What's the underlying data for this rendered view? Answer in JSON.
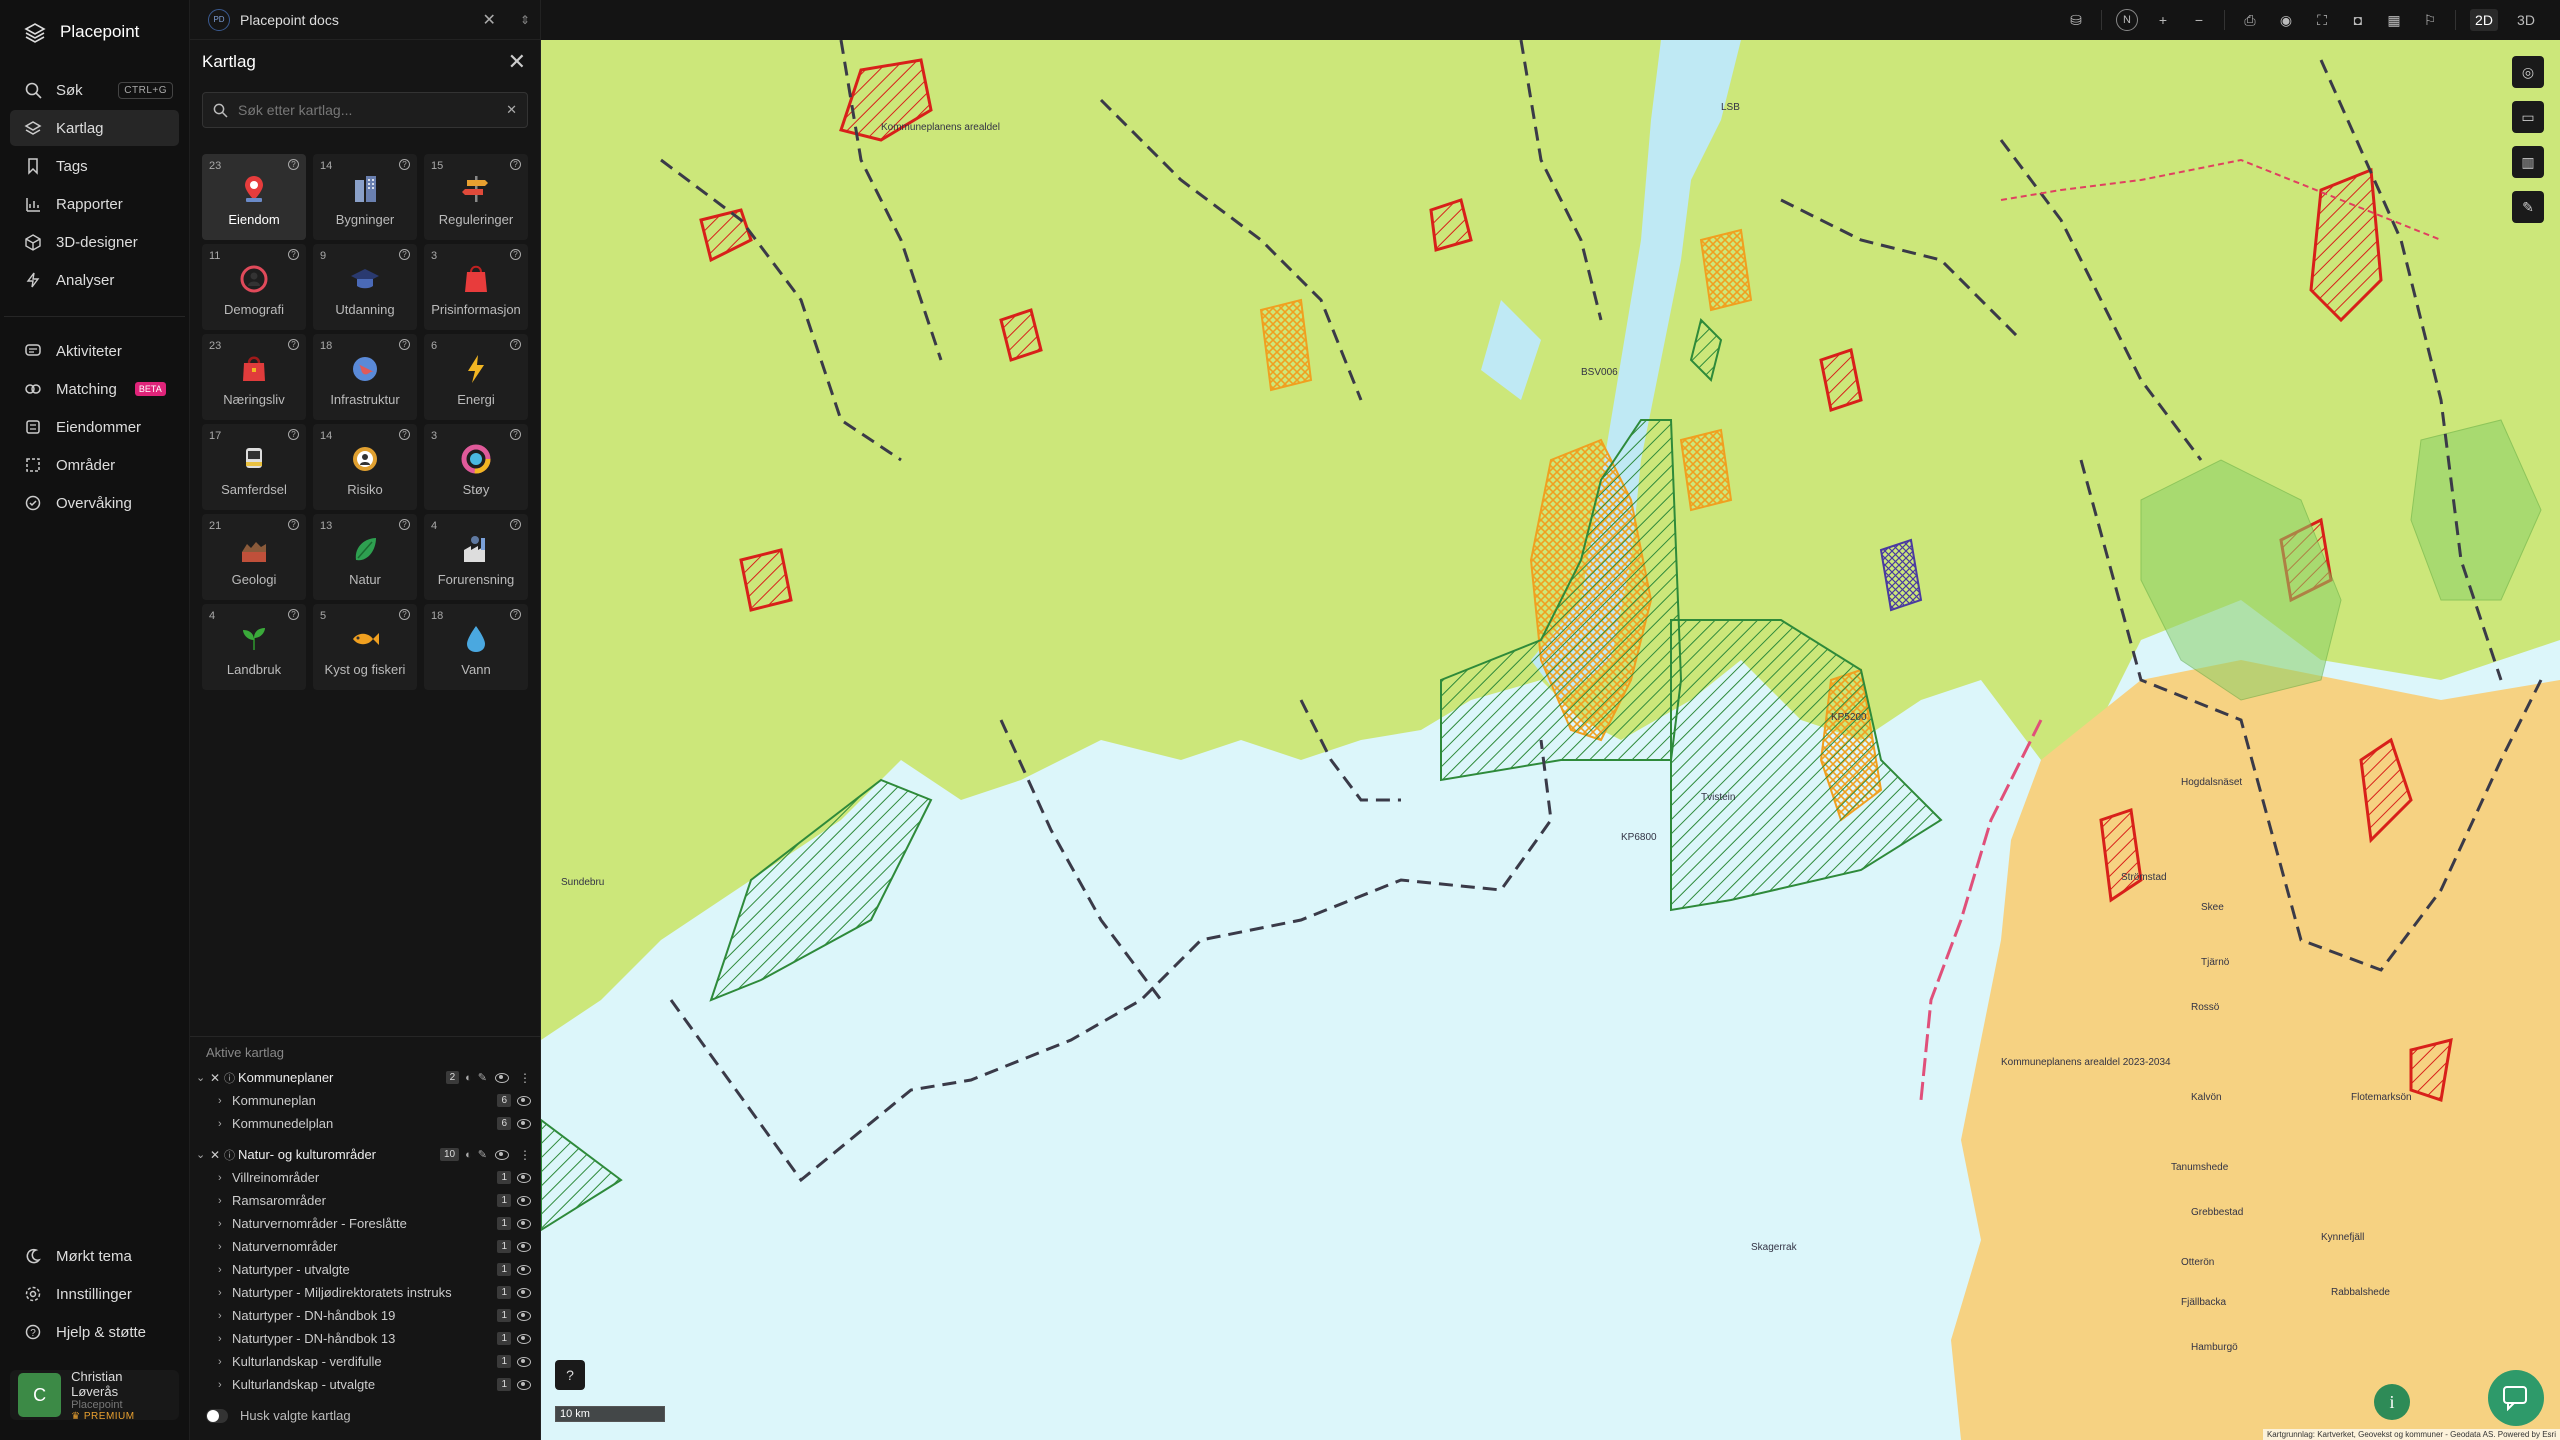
{
  "brand": {
    "name": "Placepoint"
  },
  "nav": {
    "items": [
      {
        "label": "Søk",
        "kbd": "CTRL+G",
        "icon": "search-icon"
      },
      {
        "label": "Kartlag",
        "icon": "layers-icon",
        "active": true
      },
      {
        "label": "Tags",
        "icon": "bookmark-icon"
      },
      {
        "label": "Rapporter",
        "icon": "chart-icon"
      },
      {
        "label": "3D-designer",
        "icon": "cube-icon"
      },
      {
        "label": "Analyser",
        "icon": "bolt-icon"
      }
    ],
    "items2": [
      {
        "label": "Aktiviteter",
        "icon": "message-icon"
      },
      {
        "label": "Matching",
        "badge": "BETA",
        "icon": "matching-icon"
      },
      {
        "label": "Eiendommer",
        "icon": "list-icon"
      },
      {
        "label": "Områder",
        "icon": "area-icon"
      },
      {
        "label": "Overvåking",
        "icon": "monitor-icon"
      }
    ],
    "bottom": [
      {
        "label": "Mørkt tema",
        "icon": "moon-icon"
      },
      {
        "label": "Innstillinger",
        "icon": "gear-icon"
      },
      {
        "label": "Hjelp & støtte",
        "icon": "help-icon"
      }
    ],
    "user": {
      "initial": "C",
      "name": "Christian Løverås",
      "org": "Placepoint",
      "plan": "PREMIUM"
    }
  },
  "doc_tab": {
    "badge": "PD",
    "label": "Placepoint docs"
  },
  "panel": {
    "title": "Kartlag",
    "search_placeholder": "Søk etter kartlag...",
    "tiles": [
      {
        "count": "23",
        "label": "Eiendom",
        "icon": "property-icon",
        "color": "#e63c3c",
        "active": true
      },
      {
        "count": "14",
        "label": "Bygninger",
        "icon": "buildings-icon",
        "color": "#8aa0c8"
      },
      {
        "count": "15",
        "label": "Reguleringer",
        "icon": "signpost-icon",
        "color": "#e8a030"
      },
      {
        "count": "11",
        "label": "Demografi",
        "icon": "demography-icon",
        "color": "#e04a5a"
      },
      {
        "count": "9",
        "label": "Utdanning",
        "icon": "graduation-icon",
        "color": "#4a6ab8"
      },
      {
        "count": "3",
        "label": "Prisinformasjon",
        "icon": "price-icon",
        "color": "#e83c3c"
      },
      {
        "count": "23",
        "label": "Næringsliv",
        "icon": "business-icon",
        "color": "#e03c3c"
      },
      {
        "count": "18",
        "label": "Infrastruktur",
        "icon": "globe-icon",
        "color": "#5a8ad8"
      },
      {
        "count": "6",
        "label": "Energi",
        "icon": "lightning-icon",
        "color": "#f2b622"
      },
      {
        "count": "17",
        "label": "Samferdsel",
        "icon": "bus-icon",
        "color": "#e8c040"
      },
      {
        "count": "14",
        "label": "Risiko",
        "icon": "risk-icon",
        "color": "#e0a030"
      },
      {
        "count": "3",
        "label": "Støy",
        "icon": "noise-icon",
        "color": "#e05a9a"
      },
      {
        "count": "21",
        "label": "Geologi",
        "icon": "geology-icon",
        "color": "#c0503a"
      },
      {
        "count": "13",
        "label": "Natur",
        "icon": "leaf-icon",
        "color": "#2ea050"
      },
      {
        "count": "4",
        "label": "Forurensning",
        "icon": "factory-icon",
        "color": "#7aa0d8"
      },
      {
        "count": "4",
        "label": "Landbruk",
        "icon": "plant-icon",
        "color": "#3aaa3a"
      },
      {
        "count": "5",
        "label": "Kyst og fiskeri",
        "icon": "fish-icon",
        "color": "#f0a020"
      },
      {
        "count": "18",
        "label": "Vann",
        "icon": "water-drop-icon",
        "color": "#4aa8e0"
      }
    ],
    "active_header": "Aktive kartlag",
    "groups": [
      {
        "label": "Kommuneplaner",
        "count": "2",
        "children": [
          {
            "label": "Kommuneplan",
            "count": "6"
          },
          {
            "label": "Kommunedelplan",
            "count": "6"
          }
        ]
      },
      {
        "label": "Natur- og kulturområder",
        "count": "10",
        "children": [
          {
            "label": "Villreinområder",
            "count": "1"
          },
          {
            "label": "Ramsarområder",
            "count": "1"
          },
          {
            "label": "Naturvernområder - Foreslåtte",
            "count": "1"
          },
          {
            "label": "Naturvernområder",
            "count": "1"
          },
          {
            "label": "Naturtyper - utvalgte",
            "count": "1"
          },
          {
            "label": "Naturtyper - Miljødirektoratets instruks",
            "count": "1"
          },
          {
            "label": "Naturtyper - DN-håndbok 19",
            "count": "1"
          },
          {
            "label": "Naturtyper - DN-håndbok 13",
            "count": "1"
          },
          {
            "label": "Kulturlandskap - verdifulle",
            "count": "1"
          },
          {
            "label": "Kulturlandskap - utvalgte",
            "count": "1"
          }
        ]
      }
    ],
    "remember_label": "Husk valgte kartlag"
  },
  "topbar": {
    "north": "N",
    "mode_2d": "2D",
    "mode_3d": "3D"
  },
  "map": {
    "scale_label": "10 km",
    "attribution": "Kartgrunnlag: Kartverket, Geovekst og kommuner - Geodata AS. Powered by Esri",
    "places": [
      {
        "name": "Tvistein"
      },
      {
        "name": "Skagerrak"
      },
      {
        "name": "Strömstad"
      },
      {
        "name": "Skee"
      },
      {
        "name": "Tjärnö"
      },
      {
        "name": "Rossö"
      },
      {
        "name": "Kalvön"
      },
      {
        "name": "Tanumshede"
      },
      {
        "name": "Grebbestad"
      },
      {
        "name": "Otterön"
      },
      {
        "name": "Fjällbacka"
      },
      {
        "name": "Hamburgö"
      },
      {
        "name": "Hogdalsnäset"
      },
      {
        "name": "Kynnefjäll"
      },
      {
        "name": "Rabbalshede"
      },
      {
        "name": "Flotemarksön"
      },
      {
        "name": "Sundebru"
      },
      {
        "name": "Kommuneplanens arealdel"
      },
      {
        "name": "Kommuneplanens arealdel 2023-2034"
      },
      {
        "name": "KP6800"
      },
      {
        "name": "KP5200"
      },
      {
        "name": "LSB"
      },
      {
        "name": "BSV006"
      }
    ]
  },
  "colors": {
    "accent": "#2e9a6a",
    "land": "#cde87a",
    "water": "#d8f4f8",
    "sweden": "#f6d282",
    "plan_red": "#d8201a",
    "hatch_green": "#2e8a3a",
    "hatch_orange": "#f0a020"
  }
}
